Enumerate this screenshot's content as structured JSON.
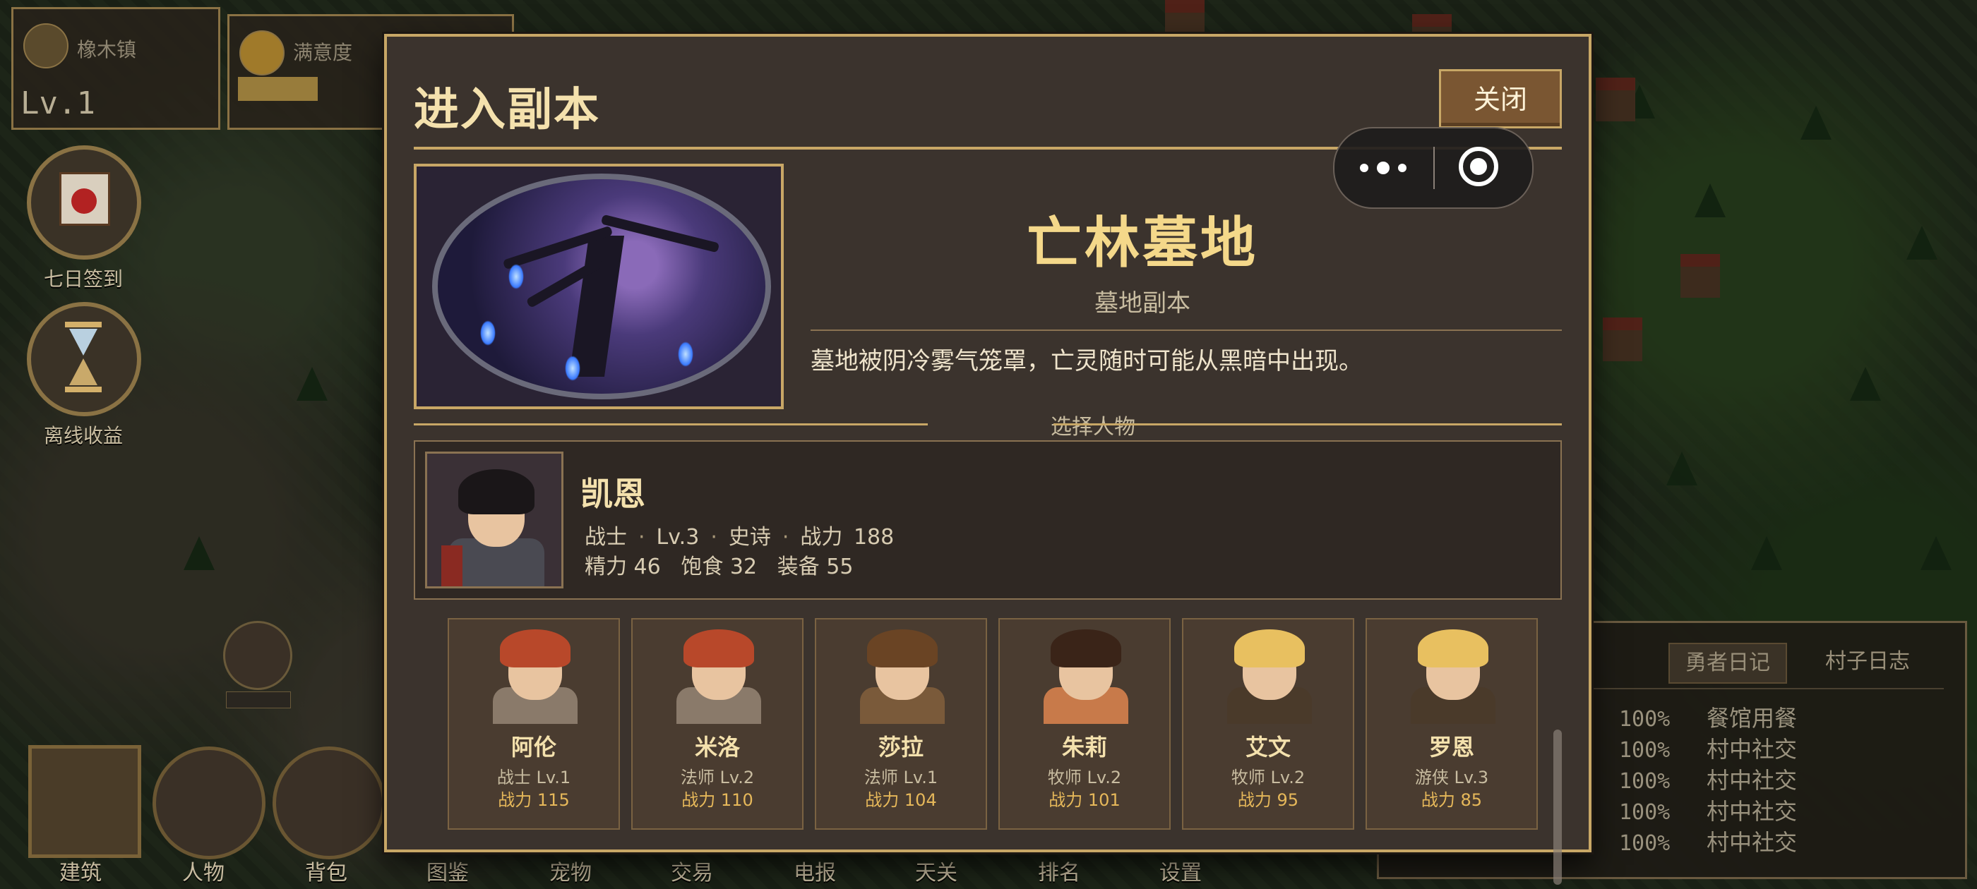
{
  "hud": {
    "town_name": "橡木镇",
    "level": "Lv.1",
    "satisfaction_label": "满意度",
    "satisfaction_fill": 0.3
  },
  "side_buttons": [
    {
      "label": "七日签到",
      "icon": "calendar-icon"
    },
    {
      "label": "离线收益",
      "icon": "hourglass-icon"
    }
  ],
  "bottom_nav": [
    "建筑",
    "人物",
    "背包",
    "图鉴",
    "宠物",
    "交易",
    "电报",
    "天关",
    "排名",
    "设置"
  ],
  "log_panel": {
    "tabs": [
      "勇者日记",
      "村子日志"
    ],
    "rows": [
      {
        "pct": "100%",
        "text": "餐馆用餐"
      },
      {
        "pct": "100%",
        "text": "村中社交"
      },
      {
        "pct": "100%",
        "text": "村中社交"
      },
      {
        "pct": "100%",
        "text": "村中社交"
      },
      {
        "pct": "100%",
        "text": "村中社交"
      }
    ]
  },
  "modal": {
    "title": "进入副本",
    "close_label": "关闭",
    "dungeon": {
      "name": "亡林墓地",
      "type": "墓地副本",
      "description": "墓地被阴冷雾气笼罩，亡灵随时可能从黑暗中出现。"
    },
    "select_label": "选择人物",
    "selected": {
      "name": "凯恩",
      "class": "战士",
      "level": "Lv.3",
      "rarity": "史诗",
      "power_label": "战力",
      "power": "188",
      "energy_label": "精力",
      "energy": "46",
      "food_label": "饱食",
      "food": "32",
      "gear_label": "装备",
      "gear": "55"
    },
    "roster": [
      {
        "name": "阿伦",
        "class_level": "战士 Lv.1",
        "power": "战力 115",
        "hair": "#b8482a",
        "outfit": "#8a7a6a"
      },
      {
        "name": "米洛",
        "class_level": "法师 Lv.2",
        "power": "战力 110",
        "hair": "#b8482a",
        "outfit": "#8a7a6a"
      },
      {
        "name": "莎拉",
        "class_level": "法师 Lv.1",
        "power": "战力 104",
        "hair": "#6a4424",
        "outfit": "#7a5a3a"
      },
      {
        "name": "朱莉",
        "class_level": "牧师 Lv.2",
        "power": "战力 101",
        "hair": "#3a2418",
        "outfit": "#c87a4a"
      },
      {
        "name": "艾文",
        "class_level": "牧师 Lv.2",
        "power": "战力 95",
        "hair": "#e8c060",
        "outfit": "#4a3a2a"
      },
      {
        "name": "罗恩",
        "class_level": "游侠 Lv.3",
        "power": "战力 85",
        "hair": "#e8c060",
        "outfit": "#4a3a2a"
      }
    ]
  }
}
